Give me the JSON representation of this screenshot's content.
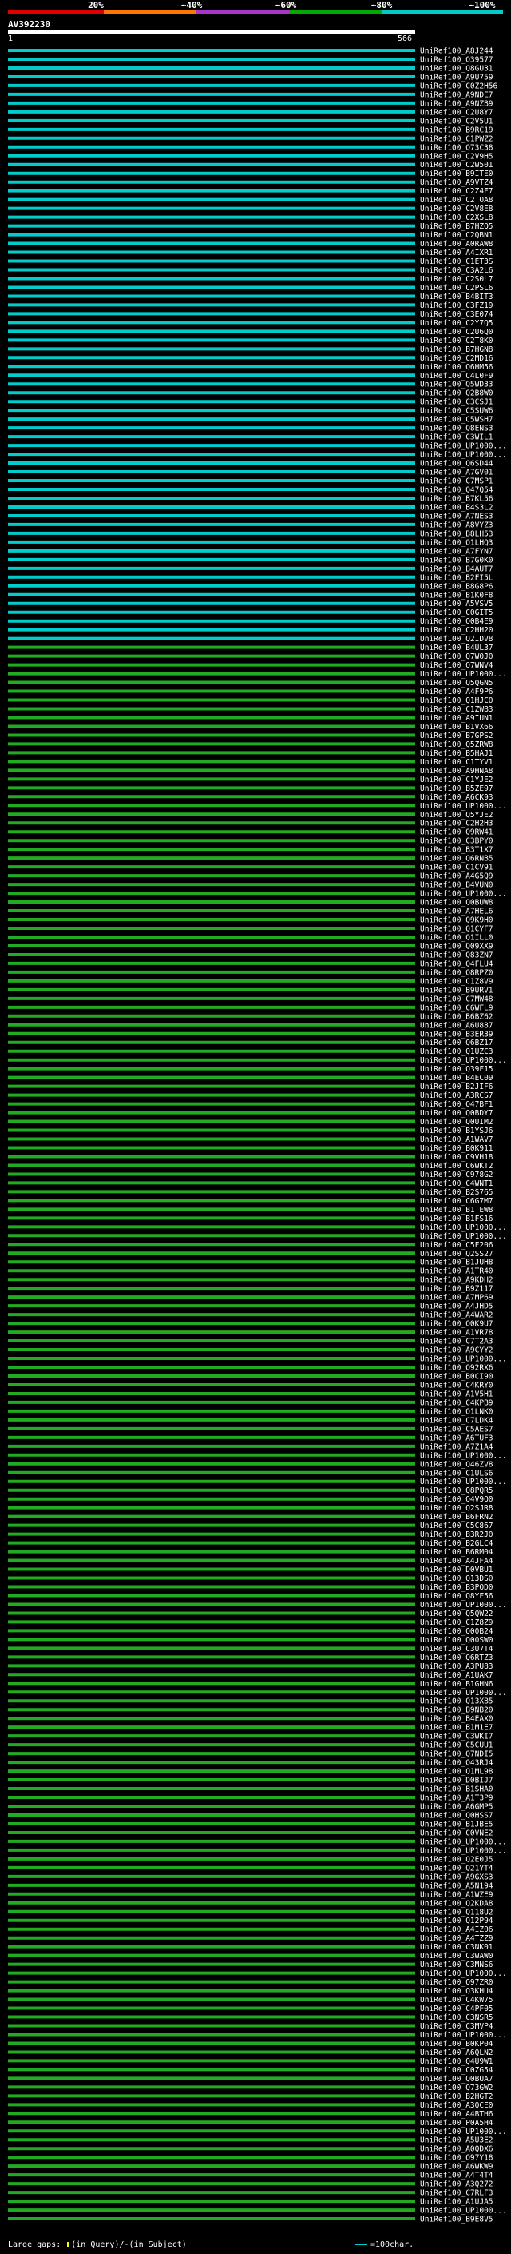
{
  "scale": {
    "labels": [
      "20%",
      "~40%",
      "~60%",
      "~80%",
      "~100%"
    ],
    "colors": [
      "#dd0000",
      "#ff7700",
      "#aa33cc",
      "#00aa00",
      "#00cccc"
    ]
  },
  "query": {
    "id": "AV392230",
    "start": "1",
    "end": "566"
  },
  "footer": {
    "large_gaps": "Large gaps:",
    "in_query": "(in Query)/",
    "dash": "-",
    "in_subject": "(in Subject)",
    "legend": "=100char."
  },
  "colors": {
    "green": "#22aa22",
    "cyan": "#00cccc",
    "white": "#ffffff",
    "yellow": "#ffff00"
  },
  "chart_data": {
    "type": "alignment-overview",
    "title": "AV392230",
    "x_range": [
      1,
      566
    ],
    "hits": [
      {
        "id": "UniRef100_A8J244",
        "band": "cyan"
      },
      {
        "id": "UniRef100_Q39577",
        "band": "cyan"
      },
      {
        "id": "UniRef100_Q8GU31",
        "band": "cyan"
      },
      {
        "id": "UniRef100_A9U759",
        "band": "cyan"
      },
      {
        "id": "UniRef100_C0Z2H56",
        "band": "cyan"
      },
      {
        "id": "UniRef100_A9NDE7",
        "band": "cyan"
      },
      {
        "id": "UniRef100_A9NZB9",
        "band": "cyan"
      },
      {
        "id": "UniRef100_C2U8Y7",
        "band": "cyan"
      },
      {
        "id": "UniRef100_C2V5U1",
        "band": "cyan"
      },
      {
        "id": "UniRef100_B9RC19",
        "band": "cyan"
      },
      {
        "id": "UniRef100_C1PWZ2",
        "band": "cyan"
      },
      {
        "id": "UniRef100_Q73C38",
        "band": "cyan"
      },
      {
        "id": "UniRef100_C2V9H5",
        "band": "cyan"
      },
      {
        "id": "UniRef100_C2W501",
        "band": "cyan"
      },
      {
        "id": "UniRef100_B9ITE0",
        "band": "cyan"
      },
      {
        "id": "UniRef100_A9VTZ4",
        "band": "cyan"
      },
      {
        "id": "UniRef100_C2Z4F7",
        "band": "cyan"
      },
      {
        "id": "UniRef100_C2TOA8",
        "band": "cyan"
      },
      {
        "id": "UniRef100_C2V8E8",
        "band": "cyan"
      },
      {
        "id": "UniRef100_C2XSL8",
        "band": "cyan"
      },
      {
        "id": "UniRef100_B7HZQ5",
        "band": "cyan"
      },
      {
        "id": "UniRef100_C2QBN1",
        "band": "cyan"
      },
      {
        "id": "UniRef100_A0RAW8",
        "band": "cyan"
      },
      {
        "id": "UniRef100_A4IXR1",
        "band": "cyan"
      },
      {
        "id": "UniRef100_C1ET3S",
        "band": "cyan"
      },
      {
        "id": "UniRef100_C3A2L6",
        "band": "cyan"
      },
      {
        "id": "UniRef100_C2S0L7",
        "band": "cyan"
      },
      {
        "id": "UniRef100_C2PSL6",
        "band": "cyan"
      },
      {
        "id": "UniRef100_B4BIT3",
        "band": "cyan"
      },
      {
        "id": "UniRef100_C3FZ19",
        "band": "cyan"
      },
      {
        "id": "UniRef100_C3E074",
        "band": "cyan"
      },
      {
        "id": "UniRef100_C2Y7Q5",
        "band": "cyan"
      },
      {
        "id": "UniRef100_C2U6Q0",
        "band": "cyan"
      },
      {
        "id": "UniRef100_C2T8K0",
        "band": "cyan"
      },
      {
        "id": "UniRef100_B7HGN8",
        "band": "cyan"
      },
      {
        "id": "UniRef100_C2MD16",
        "band": "cyan"
      },
      {
        "id": "UniRef100_Q6HM56",
        "band": "cyan"
      },
      {
        "id": "UniRef100_C4L0F9",
        "band": "cyan"
      },
      {
        "id": "UniRef100_Q5WD33",
        "band": "cyan"
      },
      {
        "id": "UniRef100_Q2B8W0",
        "band": "cyan"
      },
      {
        "id": "UniRef100_C3CSJ1",
        "band": "cyan"
      },
      {
        "id": "UniRef100_C5SUW6",
        "band": "cyan"
      },
      {
        "id": "UniRef100_C5WSH7",
        "band": "cyan"
      },
      {
        "id": "UniRef100_Q8ENS3",
        "band": "cyan"
      },
      {
        "id": "UniRef100_C3WIL1",
        "band": "cyan"
      },
      {
        "id": "UniRef100_UP1000...",
        "band": "cyan"
      },
      {
        "id": "UniRef100_UP1000...",
        "band": "cyan"
      },
      {
        "id": "UniRef100_Q6SD44",
        "band": "cyan"
      },
      {
        "id": "UniRef100_A7GV01",
        "band": "cyan"
      },
      {
        "id": "UniRef100_C7MSP1",
        "band": "cyan"
      },
      {
        "id": "UniRef100_Q47Q54",
        "band": "cyan"
      },
      {
        "id": "UniRef100_B7KL56",
        "band": "cyan"
      },
      {
        "id": "UniRef100_B4S3L2",
        "band": "cyan"
      },
      {
        "id": "UniRef100_A7NES3",
        "band": "cyan"
      },
      {
        "id": "UniRef100_A8VYZ3",
        "band": "cyan"
      },
      {
        "id": "UniRef100_B8LH53",
        "band": "cyan"
      },
      {
        "id": "UniRef100_Q1LHQ3",
        "band": "cyan"
      },
      {
        "id": "UniRef100_A7FYN7",
        "band": "cyan"
      },
      {
        "id": "UniRef100_B7G0K0",
        "band": "cyan"
      },
      {
        "id": "UniRef100_B4AUT7",
        "band": "cyan"
      },
      {
        "id": "UniRef100_B2FI5L",
        "band": "cyan"
      },
      {
        "id": "UniRef100_B8G8P6",
        "band": "cyan"
      },
      {
        "id": "UniRef100_B1K0F8",
        "band": "cyan"
      },
      {
        "id": "UniRef100_A5VSV5",
        "band": "cyan"
      },
      {
        "id": "UniRef100_C0GIT5",
        "band": "cyan"
      },
      {
        "id": "UniRef100_Q0B4E9",
        "band": "cyan"
      },
      {
        "id": "UniRef100_C2HH20",
        "band": "cyan"
      },
      {
        "id": "UniRef100_Q2IDV8",
        "band": "cyan"
      },
      {
        "id": "UniRef100_B4UL37",
        "band": "green"
      },
      {
        "id": "UniRef100_Q7W0J0",
        "band": "green"
      },
      {
        "id": "UniRef100_Q7WNV4",
        "band": "green"
      },
      {
        "id": "UniRef100_UP1000...",
        "band": "green"
      },
      {
        "id": "UniRef100_Q5QGN5",
        "band": "green"
      },
      {
        "id": "UniRef100_A4F9P6",
        "band": "green"
      },
      {
        "id": "UniRef100_Q1HJC0",
        "band": "green"
      },
      {
        "id": "UniRef100_C1ZWB3",
        "band": "green"
      },
      {
        "id": "UniRef100_A9IUN1",
        "band": "green"
      },
      {
        "id": "UniRef100_B1VX66",
        "band": "green"
      },
      {
        "id": "UniRef100_B7GPS2",
        "band": "green"
      },
      {
        "id": "UniRef100_Q5ZRW8",
        "band": "green"
      },
      {
        "id": "UniRef100_B5HAJ1",
        "band": "green"
      },
      {
        "id": "UniRef100_C1TYV1",
        "band": "green"
      },
      {
        "id": "UniRef100_A9HNA8",
        "band": "green"
      },
      {
        "id": "UniRef100_C1YJE2",
        "band": "green"
      },
      {
        "id": "UniRef100_B5ZE97",
        "band": "green"
      },
      {
        "id": "UniRef100_A6CK93",
        "band": "green"
      },
      {
        "id": "UniRef100_UP1000...",
        "band": "green"
      },
      {
        "id": "UniRef100_Q5YJE2",
        "band": "green"
      },
      {
        "id": "UniRef100_C2H2H3",
        "band": "green"
      },
      {
        "id": "UniRef100_Q9RW41",
        "band": "green"
      },
      {
        "id": "UniRef100_C3BPY0",
        "band": "green"
      },
      {
        "id": "UniRef100_B3T1X7",
        "band": "green"
      },
      {
        "id": "UniRef100_Q6RNB5",
        "band": "green"
      },
      {
        "id": "UniRef100_C1CV91",
        "band": "green"
      },
      {
        "id": "UniRef100_A4G5Q9",
        "band": "green"
      },
      {
        "id": "UniRef100_B4VUN0",
        "band": "green"
      },
      {
        "id": "UniRef100_UP1000...",
        "band": "green"
      },
      {
        "id": "UniRef100_Q0BUW8",
        "band": "green"
      },
      {
        "id": "UniRef100_A7HEL6",
        "band": "green"
      },
      {
        "id": "UniRef100_Q9K9H0",
        "band": "green"
      },
      {
        "id": "UniRef100_Q1CYF7",
        "band": "green"
      },
      {
        "id": "UniRef100_Q1ILL0",
        "band": "green"
      },
      {
        "id": "UniRef100_Q09XX9",
        "band": "green"
      },
      {
        "id": "UniRef100_Q83ZN7",
        "band": "green"
      },
      {
        "id": "UniRef100_Q4FLU4",
        "band": "green"
      },
      {
        "id": "UniRef100_Q8RPZ0",
        "band": "green"
      },
      {
        "id": "UniRef100_C1Z8V9",
        "band": "green"
      },
      {
        "id": "UniRef100_B9URV1",
        "band": "green"
      },
      {
        "id": "UniRef100_C7MW48",
        "band": "green"
      },
      {
        "id": "UniRef100_C6WFL9",
        "band": "green"
      },
      {
        "id": "UniRef100_B6BZ62",
        "band": "green"
      },
      {
        "id": "UniRef100_A6U887",
        "band": "green"
      },
      {
        "id": "UniRef100_B3ER39",
        "band": "green"
      },
      {
        "id": "UniRef100_Q6BZ17",
        "band": "green"
      },
      {
        "id": "UniRef100_Q1UZC3",
        "band": "green"
      },
      {
        "id": "UniRef100_UP1000...",
        "band": "green"
      },
      {
        "id": "UniRef100_Q39F15",
        "band": "green"
      },
      {
        "id": "UniRef100_B4EC09",
        "band": "green"
      },
      {
        "id": "UniRef100_B2JIF6",
        "band": "green"
      },
      {
        "id": "UniRef100_A3RCS7",
        "band": "green"
      },
      {
        "id": "UniRef100_Q47BF1",
        "band": "green"
      },
      {
        "id": "UniRef100_Q0BDY7",
        "band": "green"
      },
      {
        "id": "UniRef100_Q0UIM2",
        "band": "green"
      },
      {
        "id": "UniRef100_B1YSJ6",
        "band": "green"
      },
      {
        "id": "UniRef100_A1WAV7",
        "band": "green"
      },
      {
        "id": "UniRef100_B0K911",
        "band": "green"
      },
      {
        "id": "UniRef100_C9VH18",
        "band": "green"
      },
      {
        "id": "UniRef100_C6WKT2",
        "band": "green"
      },
      {
        "id": "UniRef100_C978G2",
        "band": "green"
      },
      {
        "id": "UniRef100_C4WNT1",
        "band": "green"
      },
      {
        "id": "UniRef100_B2S765",
        "band": "green"
      },
      {
        "id": "UniRef100_C6G7M7",
        "band": "green"
      },
      {
        "id": "UniRef100_B1TEW8",
        "band": "green"
      },
      {
        "id": "UniRef100_B1FS16",
        "band": "green"
      },
      {
        "id": "UniRef100_UP1000...",
        "band": "green"
      },
      {
        "id": "UniRef100_UP1000...",
        "band": "green"
      },
      {
        "id": "UniRef100_C5F206",
        "band": "green"
      },
      {
        "id": "UniRef100_Q2SS27",
        "band": "green"
      },
      {
        "id": "UniRef100_B1JUH8",
        "band": "green"
      },
      {
        "id": "UniRef100_A1TR40",
        "band": "green"
      },
      {
        "id": "UniRef100_A9KDH2",
        "band": "green"
      },
      {
        "id": "UniRef100_B9Z117",
        "band": "green"
      },
      {
        "id": "UniRef100_A7MP69",
        "band": "green"
      },
      {
        "id": "UniRef100_A4JHD5",
        "band": "green"
      },
      {
        "id": "UniRef100_A4WAR2",
        "band": "green"
      },
      {
        "id": "UniRef100_Q0K9U7",
        "band": "green"
      },
      {
        "id": "UniRef100_A1VR78",
        "band": "green"
      },
      {
        "id": "UniRef100_C7T2A3",
        "band": "green"
      },
      {
        "id": "UniRef100_A9CYY2",
        "band": "green"
      },
      {
        "id": "UniRef100_UP1000...",
        "band": "green"
      },
      {
        "id": "UniRef100_Q92RX6",
        "band": "green"
      },
      {
        "id": "UniRef100_B0CI90",
        "band": "green"
      },
      {
        "id": "UniRef100_C4KRY0",
        "band": "green"
      },
      {
        "id": "UniRef100_A1V5H1",
        "band": "green"
      },
      {
        "id": "UniRef100_C4KPB9",
        "band": "green"
      },
      {
        "id": "UniRef100_Q1LNK0",
        "band": "green"
      },
      {
        "id": "UniRef100_C7LDK4",
        "band": "green"
      },
      {
        "id": "UniRef100_C5AES7",
        "band": "green"
      },
      {
        "id": "UniRef100_A6TUF3",
        "band": "green"
      },
      {
        "id": "UniRef100_A7Z1A4",
        "band": "green"
      },
      {
        "id": "UniRef100_UP1000...",
        "band": "green"
      },
      {
        "id": "UniRef100_Q46ZV8",
        "band": "green"
      },
      {
        "id": "UniRef100_C1ULS6",
        "band": "green"
      },
      {
        "id": "UniRef100_UP1000...",
        "band": "green"
      },
      {
        "id": "UniRef100_Q8PQR5",
        "band": "green"
      },
      {
        "id": "UniRef100_Q4V9Q0",
        "band": "green"
      },
      {
        "id": "UniRef100_Q2SJR8",
        "band": "green"
      },
      {
        "id": "UniRef100_B6FRN2",
        "band": "green"
      },
      {
        "id": "UniRef100_C5C867",
        "band": "green"
      },
      {
        "id": "UniRef100_B3R2J0",
        "band": "green"
      },
      {
        "id": "UniRef100_B2GLC4",
        "band": "green"
      },
      {
        "id": "UniRef100_B6RM04",
        "band": "green"
      },
      {
        "id": "UniRef100_A4JFA4",
        "band": "green"
      },
      {
        "id": "UniRef100_D0VBU1",
        "band": "green"
      },
      {
        "id": "UniRef100_Q13DS0",
        "band": "green"
      },
      {
        "id": "UniRef100_B3PQD0",
        "band": "green"
      },
      {
        "id": "UniRef100_Q8YF56",
        "band": "green"
      },
      {
        "id": "UniRef100_UP1000...",
        "band": "green"
      },
      {
        "id": "UniRef100_Q5QW22",
        "band": "green"
      },
      {
        "id": "UniRef100_C1Z8Z9",
        "band": "green"
      },
      {
        "id": "UniRef100_Q00B24",
        "band": "green"
      },
      {
        "id": "UniRef100_Q00SW0",
        "band": "green"
      },
      {
        "id": "UniRef100_C3U7T4",
        "band": "green"
      },
      {
        "id": "UniRef100_Q6RTZ3",
        "band": "green"
      },
      {
        "id": "UniRef100_A3PU83",
        "band": "green"
      },
      {
        "id": "UniRef100_A1UAK7",
        "band": "green"
      },
      {
        "id": "UniRef100_B1GHN6",
        "band": "green"
      },
      {
        "id": "UniRef100_UP1000...",
        "band": "green"
      },
      {
        "id": "UniRef100_Q13XB5",
        "band": "green"
      },
      {
        "id": "UniRef100_B9NB20",
        "band": "green"
      },
      {
        "id": "UniRef100_B4EAX0",
        "band": "green"
      },
      {
        "id": "UniRef100_B1M1E7",
        "band": "green"
      },
      {
        "id": "UniRef100_C3WKI7",
        "band": "green"
      },
      {
        "id": "UniRef100_C5CUU1",
        "band": "green"
      },
      {
        "id": "UniRef100_Q7NDI5",
        "band": "green"
      },
      {
        "id": "UniRef100_Q43RJ4",
        "band": "green"
      },
      {
        "id": "UniRef100_Q1ML98",
        "band": "green"
      },
      {
        "id": "UniRef100_D0BIJ7",
        "band": "green"
      },
      {
        "id": "UniRef100_B1SHA0",
        "band": "green"
      },
      {
        "id": "UniRef100_A1T3P9",
        "band": "green"
      },
      {
        "id": "UniRef100_A6GMP5",
        "band": "green"
      },
      {
        "id": "UniRef100_Q0HSS7",
        "band": "green"
      },
      {
        "id": "UniRef100_B1JBE5",
        "band": "green"
      },
      {
        "id": "UniRef100_C0VNE2",
        "band": "green"
      },
      {
        "id": "UniRef100_UP1000...",
        "band": "green"
      },
      {
        "id": "UniRef100_UP1000...",
        "band": "green"
      },
      {
        "id": "UniRef100_Q2E0J5",
        "band": "green"
      },
      {
        "id": "UniRef100_Q21YT4",
        "band": "green"
      },
      {
        "id": "UniRef100_A9GXS3",
        "band": "green"
      },
      {
        "id": "UniRef100_A5N194",
        "band": "green"
      },
      {
        "id": "UniRef100_A1WZE9",
        "band": "green"
      },
      {
        "id": "UniRef100_Q2KDA8",
        "band": "green"
      },
      {
        "id": "UniRef100_Q118U2",
        "band": "green"
      },
      {
        "id": "UniRef100_Q12P94",
        "band": "green"
      },
      {
        "id": "UniRef100_A4IZ06",
        "band": "green"
      },
      {
        "id": "UniRef100_A4TZZ9",
        "band": "green"
      },
      {
        "id": "UniRef100_C3NK01",
        "band": "green"
      },
      {
        "id": "UniRef100_C3WAW0",
        "band": "green"
      },
      {
        "id": "UniRef100_C3MNS6",
        "band": "green"
      },
      {
        "id": "UniRef100_UP1000...",
        "band": "green"
      },
      {
        "id": "UniRef100_Q97ZR0",
        "band": "green"
      },
      {
        "id": "UniRef100_Q3KHU4",
        "band": "green"
      },
      {
        "id": "UniRef100_C4KW75",
        "band": "green"
      },
      {
        "id": "UniRef100_C4PF05",
        "band": "green"
      },
      {
        "id": "UniRef100_C3NSR5",
        "band": "green"
      },
      {
        "id": "UniRef100_C3MVP4",
        "band": "green"
      },
      {
        "id": "UniRef100_UP1000...",
        "band": "green"
      },
      {
        "id": "UniRef100_B0KP04",
        "band": "green"
      },
      {
        "id": "UniRef100_A6QLN2",
        "band": "green"
      },
      {
        "id": "UniRef100_Q4U9W1",
        "band": "green"
      },
      {
        "id": "UniRef100_C0ZG54",
        "band": "green"
      },
      {
        "id": "UniRef100_Q0BUA7",
        "band": "green"
      },
      {
        "id": "UniRef100_Q73GW2",
        "band": "green"
      },
      {
        "id": "UniRef100_B2HGT2",
        "band": "green"
      },
      {
        "id": "UniRef100_A3QCE0",
        "band": "green"
      },
      {
        "id": "UniRef100_A4BTH6",
        "band": "green"
      },
      {
        "id": "UniRef100_P0A5H4",
        "band": "green"
      },
      {
        "id": "UniRef100_UP1000...",
        "band": "green"
      },
      {
        "id": "UniRef100_A5U3E2",
        "band": "green"
      },
      {
        "id": "UniRef100_A0QDX6",
        "band": "green"
      },
      {
        "id": "UniRef100_Q97Y18",
        "band": "green"
      },
      {
        "id": "UniRef100_A6WKW9",
        "band": "green"
      },
      {
        "id": "UniRef100_A4T4T4",
        "band": "green"
      },
      {
        "id": "UniRef100_A3Q272",
        "band": "green"
      },
      {
        "id": "UniRef100_C7RLF3",
        "band": "green"
      },
      {
        "id": "UniRef100_A1UJA5",
        "band": "green"
      },
      {
        "id": "UniRef100_UP1000...",
        "band": "green"
      },
      {
        "id": "UniRef100_B9E8V5",
        "band": "green"
      }
    ]
  }
}
